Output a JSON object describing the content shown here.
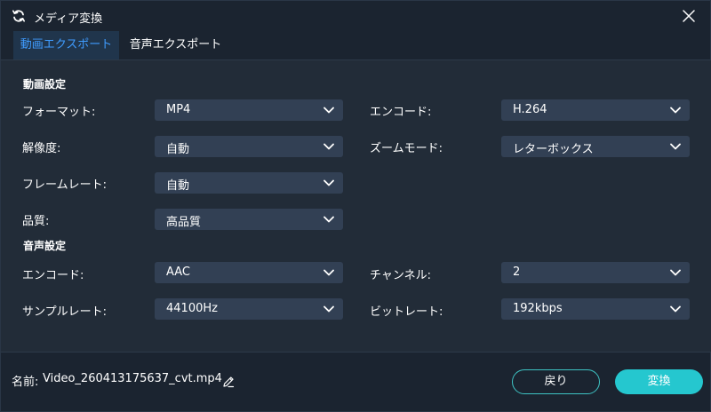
{
  "window": {
    "title": "メディア変換"
  },
  "tabs": [
    {
      "label": "動画エクスポート",
      "active": true
    },
    {
      "label": "音声エクスポート",
      "active": false
    }
  ],
  "video_settings": {
    "section_title": "動画設定",
    "format": {
      "label": "フォーマット:",
      "value": "MP4"
    },
    "encoder": {
      "label": "エンコード:",
      "value": "H.264"
    },
    "resolution": {
      "label": "解像度:",
      "value": "自動"
    },
    "zoom_mode": {
      "label": "ズームモード:",
      "value": "レターボックス"
    },
    "frame_rate": {
      "label": "フレームレート:",
      "value": "自動"
    },
    "quality": {
      "label": "品質:",
      "value": "高品質"
    }
  },
  "audio_settings": {
    "section_title": "音声設定",
    "encoder": {
      "label": "エンコード:",
      "value": "AAC"
    },
    "channel": {
      "label": "チャンネル:",
      "value": "2"
    },
    "sample_rate": {
      "label": "サンプルレート:",
      "value": "44100Hz"
    },
    "bitrate": {
      "label": "ビットレート:",
      "value": "192kbps"
    }
  },
  "footer": {
    "name_label": "名前:",
    "file_name": "Video_260413175637_cvt.mp4",
    "back_label": "戻り",
    "convert_label": "変換"
  },
  "icons": {
    "app": "refresh-icon",
    "close": "close-icon",
    "dropdown": "chevron-down-icon",
    "edit": "pencil-icon"
  },
  "colors": {
    "background": "#1b2430",
    "panel": "#222c38",
    "select": "#324054",
    "active_tab_text": "#3f9cff",
    "accent": "#25c7cf"
  }
}
